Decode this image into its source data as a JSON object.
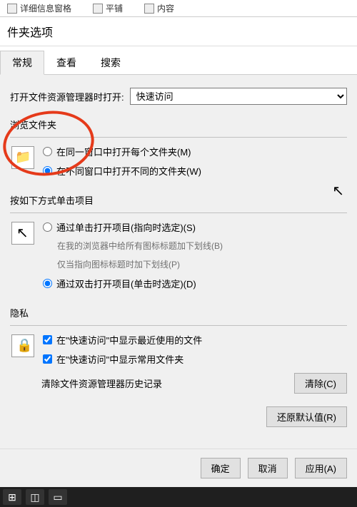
{
  "ribbon": {
    "item1": "详细信息窗格",
    "item2": "平铺",
    "item3": "内容"
  },
  "dialog": {
    "title": "件夹选项",
    "tabs": {
      "general": "常规",
      "view": "查看",
      "search": "搜索"
    },
    "open_with_label": "打开文件资源管理器时打开:",
    "open_with_value": "快速访问",
    "browse": {
      "title": "浏览文件夹",
      "opt_same": "在同一窗口中打开每个文件夹(M)",
      "opt_diff": "在不同窗口中打开不同的文件夹(W)"
    },
    "click": {
      "title": "按如下方式单击项目",
      "opt_single": "通过单击打开项目(指向时选定)(S)",
      "sub1": "在我的浏览器中给所有图标标题加下划线(B)",
      "sub2": "仅当指向图标标题时加下划线(P)",
      "opt_double": "通过双击打开项目(单击时选定)(D)"
    },
    "privacy": {
      "title": "隐私",
      "chk_recent": "在\"快速访问\"中显示最近使用的文件",
      "chk_freq": "在\"快速访问\"中显示常用文件夹",
      "clear_label": "清除文件资源管理器历史记录",
      "clear_btn": "清除(C)"
    },
    "restore_btn": "还原默认值(R)",
    "ok_btn": "确定",
    "cancel_btn": "取消",
    "apply_btn": "应用(A)"
  }
}
